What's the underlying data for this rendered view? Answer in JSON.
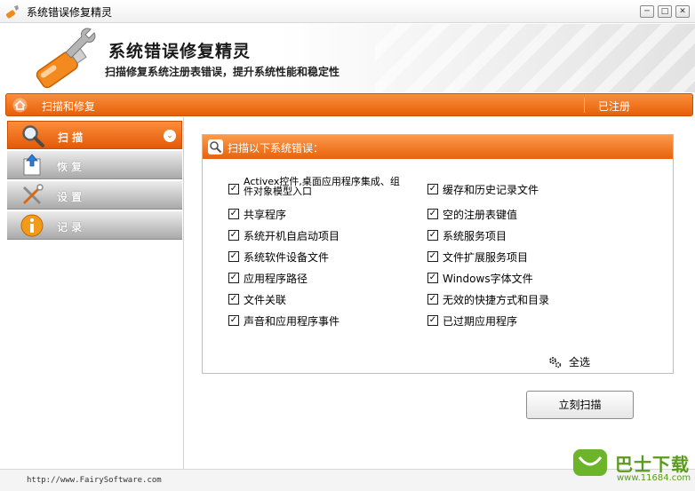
{
  "window": {
    "title": "系统错误修复精灵",
    "controls": {
      "minimize": "─",
      "maximize": "□",
      "close": "✕"
    }
  },
  "header": {
    "title": "系统错误修复精灵",
    "subtitle": "扫描修复系统注册表错误，提升系统性能和稳定性",
    "logo_icon": "wrench-usb-icon"
  },
  "navbar": {
    "title": "扫描和修复",
    "status": "已注册",
    "icon": "home-icon"
  },
  "sidebar": {
    "items": [
      {
        "label": "扫 描",
        "icon": "magnifier-icon",
        "active": true,
        "chevron": "⌄"
      },
      {
        "label": "恢 复",
        "icon": "restore-icon",
        "active": false
      },
      {
        "label": "设 置",
        "icon": "tools-icon",
        "active": false
      },
      {
        "label": "记 录",
        "icon": "info-icon",
        "active": false
      }
    ]
  },
  "panel": {
    "title": "扫描以下系统错误：",
    "left_items": [
      {
        "label": "Activex控件,桌面应用程序集成、组件对象模型入口",
        "checked": true
      },
      {
        "label": "共享程序",
        "checked": true
      },
      {
        "label": "系统开机自启动项目",
        "checked": true
      },
      {
        "label": "系统软件设备文件",
        "checked": true
      },
      {
        "label": "应用程序路径",
        "checked": true
      },
      {
        "label": "文件关联",
        "checked": true
      },
      {
        "label": "声音和应用程序事件",
        "checked": true
      }
    ],
    "right_items": [
      {
        "label": "缓存和历史记录文件",
        "checked": true
      },
      {
        "label": "空的注册表键值",
        "checked": true
      },
      {
        "label": "系统服务项目",
        "checked": true
      },
      {
        "label": "文件扩展服务项目",
        "checked": true
      },
      {
        "label": "Windows字体文件",
        "checked": true
      },
      {
        "label": "无效的快捷方式和目录",
        "checked": true
      },
      {
        "label": "已过期应用程序",
        "checked": true
      }
    ],
    "check_mark": "✓",
    "select_all": "全选"
  },
  "scan_button": "立刻扫描",
  "footer": {
    "url": "http://www.FairySoftware.com"
  },
  "watermark": {
    "text": "巴士下载",
    "url": "www.11684.com"
  },
  "colors": {
    "accent": "#e8620b",
    "accent_light": "#fb9a4c",
    "brand_green": "#5a9b1e"
  }
}
